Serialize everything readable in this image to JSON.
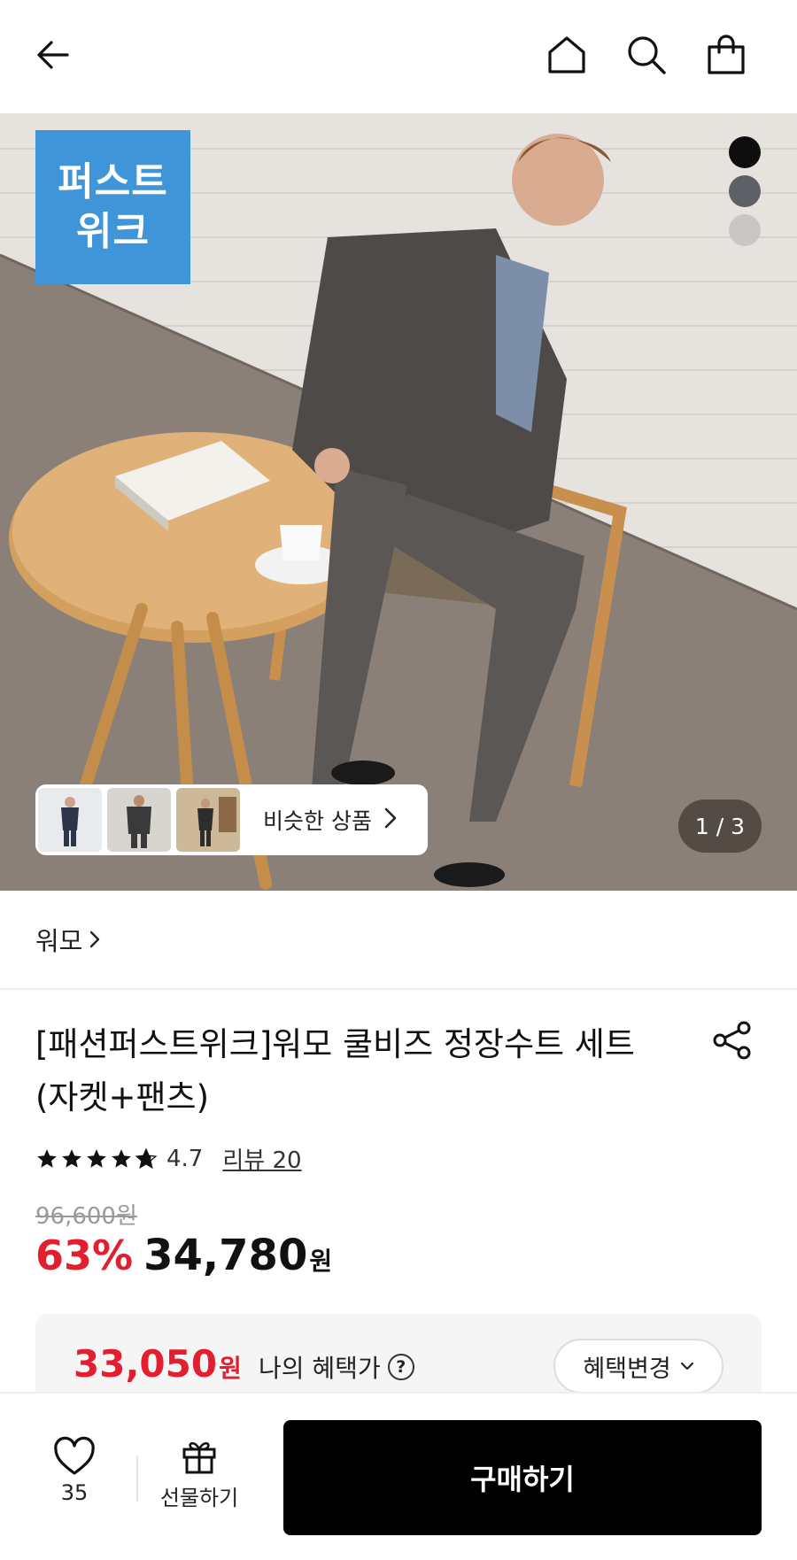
{
  "header": {
    "icons": [
      "back-arrow-icon",
      "home-icon",
      "search-icon",
      "shopping-bag-icon"
    ]
  },
  "hero": {
    "badge_line1": "퍼스트",
    "badge_line2": "위크",
    "swatch_colors": [
      "#0d0d0d",
      "#5e6066",
      "#c9c6c4"
    ],
    "similar_label": "비슷한 상품",
    "counter": "1 / 3"
  },
  "brand": {
    "name": "워모"
  },
  "product": {
    "title": "[패션퍼스트위크]워모 쿨비즈 정장수트 세트 (자켓+팬츠)",
    "rating": "4.7",
    "stars": 4.7,
    "review_label": "리뷰 20",
    "original_price": "96,600원",
    "discount": "63%",
    "price": "34,780",
    "currency": "원"
  },
  "benefit": {
    "price": "33,050",
    "currency": "원",
    "label": "나의 혜택가",
    "help": "?",
    "change_button": "혜택변경"
  },
  "bottom": {
    "like_count": "35",
    "gift_label": "선물하기",
    "buy_label": "구매하기"
  },
  "colors": {
    "accent_red": "#e31e2e",
    "badge_blue": "#3f95d8",
    "buy_button": "#000000"
  }
}
